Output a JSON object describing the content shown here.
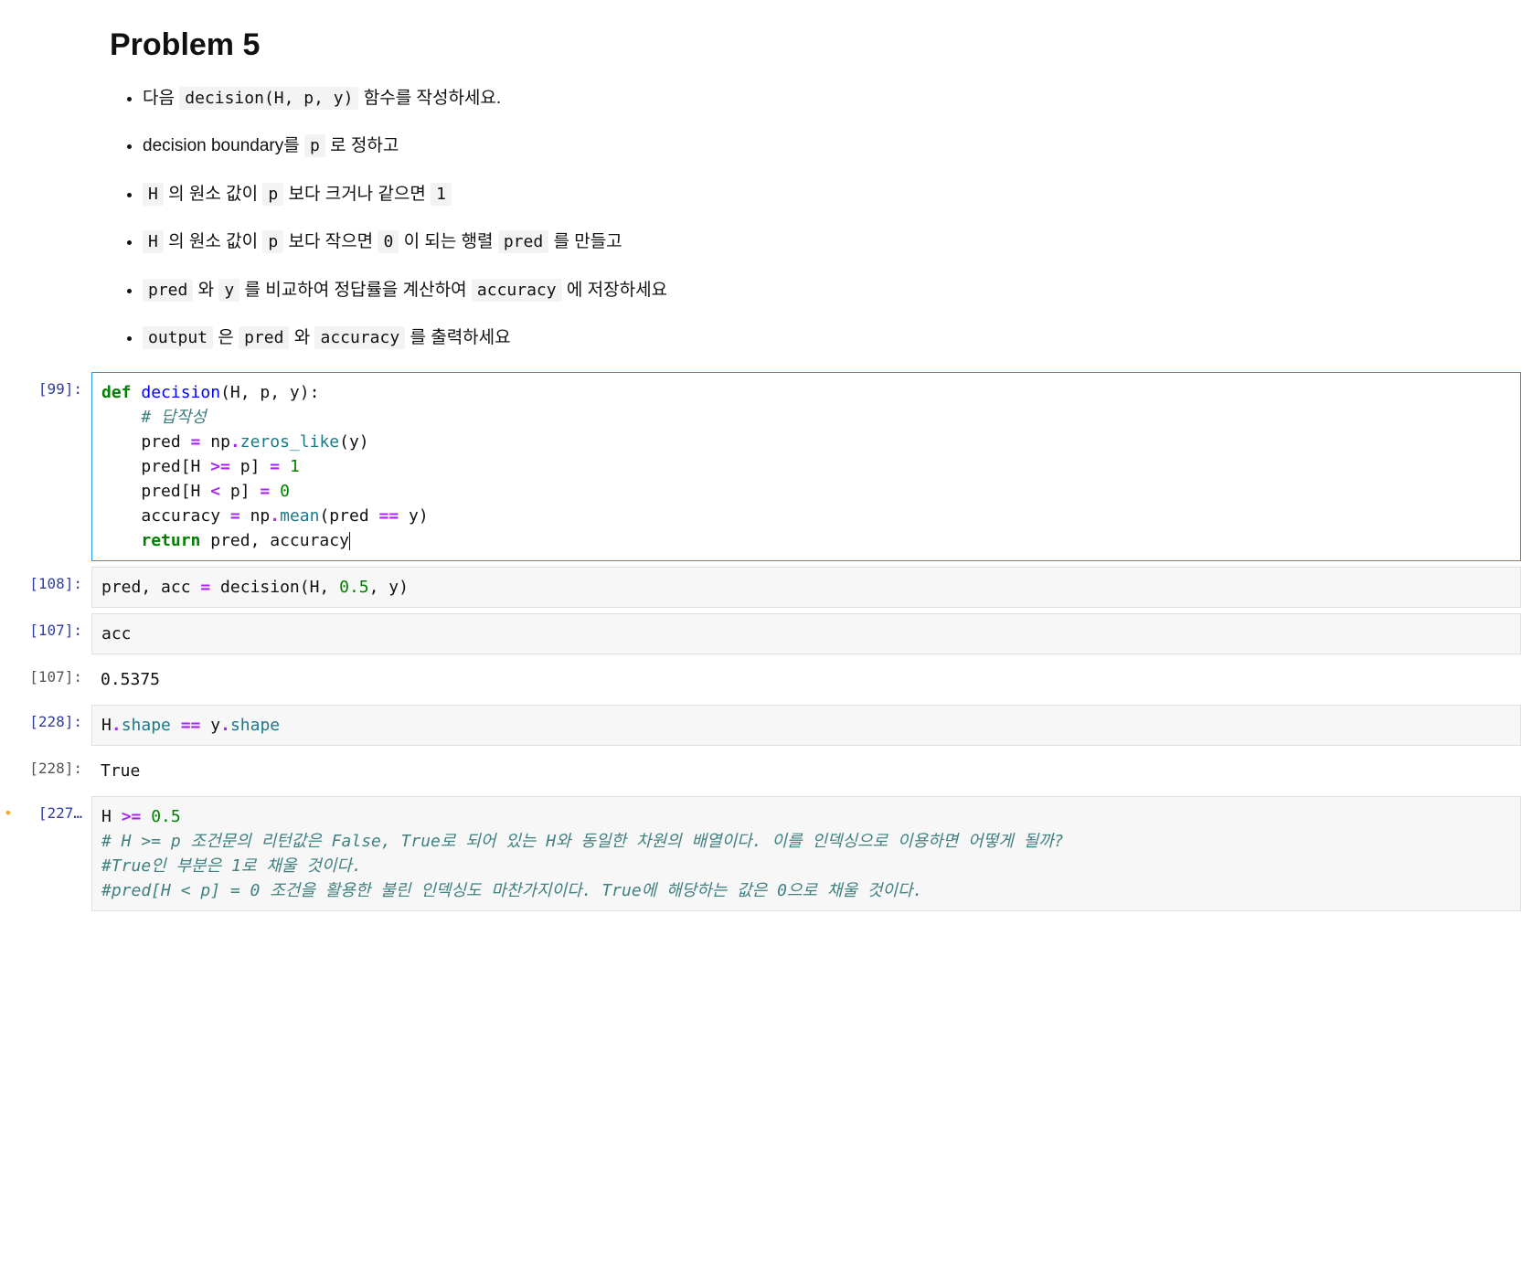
{
  "markdown": {
    "heading": "Problem 5",
    "bullets": {
      "b1_pre": "다음 ",
      "b1_code": "decision(H, p, y)",
      "b1_post": " 함수를 작성하세요.",
      "b2_pre": "decision boundary를 ",
      "b2_c1": "p",
      "b2_post": " 로 정하고",
      "b3_c1": "H",
      "b3_t1": " 의 원소 값이 ",
      "b3_c2": "p",
      "b3_t2": " 보다 크거나 같으면 ",
      "b3_c3": "1",
      "b4_c1": "H",
      "b4_t1": " 의 원소 값이 ",
      "b4_c2": "p",
      "b4_t2": " 보다 작으면 ",
      "b4_c3": "0",
      "b4_t3": " 이 되는 행렬 ",
      "b4_c4": "pred",
      "b4_t4": " 를 만들고",
      "b5_c1": "pred",
      "b5_t1": " 와 ",
      "b5_c2": "y",
      "b5_t2": " 를 비교하여 정답률을 계산하여 ",
      "b5_c3": "accuracy",
      "b5_t3": " 에 저장하세요",
      "b6_c1": "output",
      "b6_t1": " 은 ",
      "b6_c2": "pred",
      "b6_t2": " 와 ",
      "b6_c3": "accuracy",
      "b6_t3": " 를 출력하세요"
    }
  },
  "cells": [
    {
      "prompt": "[99]:",
      "active": true,
      "tokens": {
        "def": "def",
        "fname": "decision",
        "sig": "(H, p, y):",
        "indent": "    ",
        "cm1": "# 답작성",
        "l3a": "pred ",
        "op_eq": "=",
        "l3b": " np",
        "dot": ".",
        "zeros": "zeros_like",
        "l3c": "(y)",
        "l4a": "pred[H ",
        "ge": ">=",
        "l4b": " p] ",
        "l4c": " ",
        "one": "1",
        "l5a": "pred[H ",
        "lt": "<",
        "l5b": " p] ",
        "zero": "0",
        "l6a": "accuracy ",
        "l6b": " np",
        "mean": "mean",
        "l6c": "(pred ",
        "eqeq": "==",
        "l6d": " y)",
        "ret": "return",
        "l7a": " pred, accuracy"
      }
    },
    {
      "prompt": "[108]:",
      "tokens": {
        "t1": "pred, acc ",
        "op_eq": "=",
        "t2": " decision(H, ",
        "num": "0.5",
        "t3": ", y)"
      }
    },
    {
      "prompt": "[107]:",
      "tokens": {
        "t1": "acc"
      }
    },
    {
      "prompt_out": "[107]:",
      "output": "0.5375"
    },
    {
      "prompt": "[228]:",
      "tokens": {
        "t1": "H",
        "dot": ".",
        "shape1": "shape",
        "sp1": " ",
        "eqeq": "==",
        "sp2": " y",
        "shape2": "shape"
      }
    },
    {
      "prompt_out": "[228]:",
      "output": "True"
    },
    {
      "prompt": "[227…",
      "modified": true,
      "tokens": {
        "t1": "H ",
        "ge": ">=",
        "sp": " ",
        "num": "0.5",
        "cm1": "# H >= p 조건문의 리턴값은 False, True로 되어 있는 H와 동일한 차원의 배열이다. 이를 인덱싱으로 이용하면 어떻게 될까?",
        "cm2": "#True인 부분은 1로 채울 것이다.",
        "cm3": "#pred[H < p] = 0 조건을 활용한 불린 인덱싱도 마찬가지이다. True에 해당하는 값은 0으로 채울 것이다."
      }
    }
  ]
}
